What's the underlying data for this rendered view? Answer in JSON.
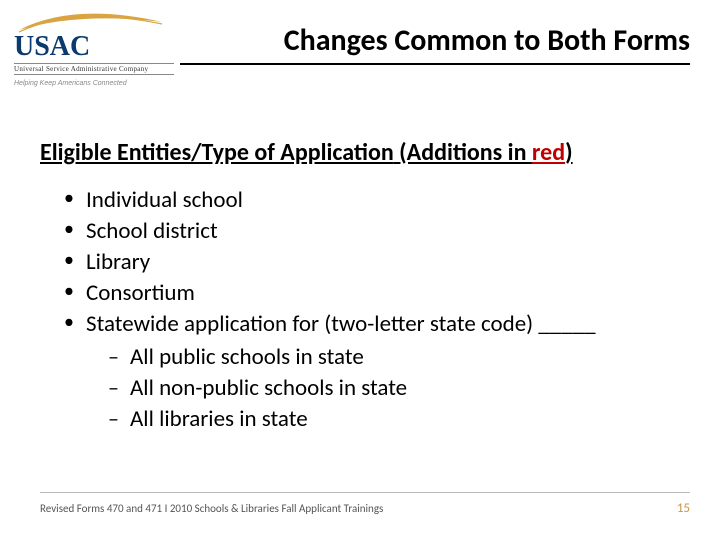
{
  "logo": {
    "name": "USAC",
    "subtitle": "Universal Service Administrative Company",
    "tagline": "Helping Keep Americans Connected"
  },
  "title": "Changes Common to Both Forms",
  "section": {
    "prefix": "Eligible Entities/Type of Application",
    "additions_open": " (Additions in ",
    "red_word": "red",
    "additions_close": ")"
  },
  "bullets": [
    "Individual school",
    "School district",
    "Library",
    "Consortium",
    "Statewide application for (two-letter state code) _____"
  ],
  "sub_bullets": [
    "All public schools in state",
    "All non-public schools in state",
    "All libraries in state"
  ],
  "footer": "Revised Forms 470 and 471 I 2010 Schools & Libraries Fall Applicant Trainings",
  "page": "15"
}
